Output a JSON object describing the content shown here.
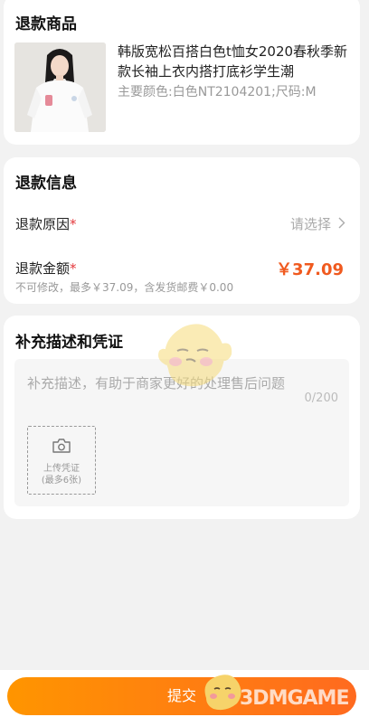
{
  "product_section": {
    "title": "退款商品",
    "product_name": "韩版宽松百搭白色t恤女2020春秋季新款长袖上衣内搭打底衫学生潮",
    "product_spec": "主要颜色:白色NT2104201;尺码:M"
  },
  "refund_info": {
    "title": "退款信息",
    "reason_label": "退款原因",
    "reason_required_mark": "*",
    "reason_value": "请选择",
    "amount_label": "退款金额",
    "amount_required_mark": "*",
    "amount_value": "￥37.09",
    "amount_hint": "不可修改，最多￥37.09，含发货邮费￥0.00"
  },
  "description": {
    "title": "补充描述和凭证",
    "placeholder": "补充描述，有助于商家更好的处理售后问题",
    "char_count": "0/200",
    "upload_label_line1": "上传凭证",
    "upload_label_line2": "(最多6张)"
  },
  "bottom": {
    "submit_label": "提交"
  },
  "watermark": {
    "text": "3DMGAME"
  },
  "colors": {
    "accent": "#f05a1f",
    "button_gradient_start": "#ff9500",
    "button_gradient_end": "#ff6a1f",
    "required": "#e4393c"
  }
}
